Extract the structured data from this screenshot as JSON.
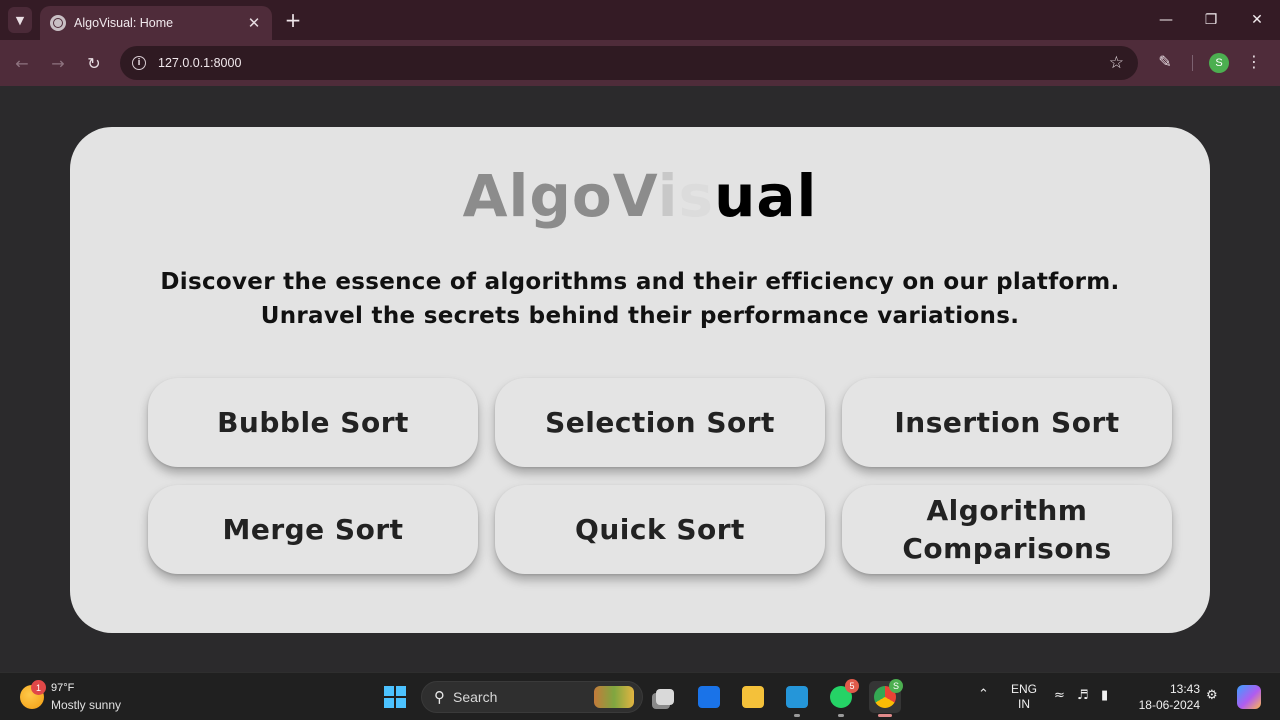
{
  "browser": {
    "tab_title": "AlgoVisual: Home",
    "url": "127.0.0.1:8000",
    "profile_initial": "S",
    "icons": {
      "tab_menu": "chevron-down-icon",
      "favicon": "globe-icon",
      "tab_close": "close-icon",
      "new_tab": "plus-icon",
      "back": "arrow-left-icon",
      "forward": "arrow-right-icon",
      "reload": "reload-icon",
      "site_info": "info-icon",
      "bookmark": "star-icon",
      "extensions": "puzzle-icon",
      "menu": "kebab-icon"
    }
  },
  "page": {
    "brand": {
      "part1": "AlgoV",
      "part2": "i",
      "part3": "s",
      "part4": "ual"
    },
    "tagline_line1": "Discover the essence of algorithms and their efficiency on our platform.",
    "tagline_line2": "Unravel the secrets behind their performance variations.",
    "buttons": [
      {
        "label": "Bubble Sort"
      },
      {
        "label": "Selection Sort"
      },
      {
        "label": "Insertion Sort"
      },
      {
        "label": "Merge Sort"
      },
      {
        "label": "Quick Sort"
      },
      {
        "label": "Algorithm Comparisons"
      }
    ],
    "colors": {
      "background": "#2b2a2c",
      "card": "#e3e3e3",
      "button": "#e4e4e4"
    }
  },
  "taskbar": {
    "weather_badge": "1",
    "weather_temp": "97°F",
    "weather_desc": "Mostly sunny",
    "search_label": "Search",
    "whatsapp_badge": "5",
    "chrome_badge": "S",
    "lang_line1": "ENG",
    "lang_line2": "IN",
    "time": "13:43",
    "date": "18-06-2024"
  }
}
